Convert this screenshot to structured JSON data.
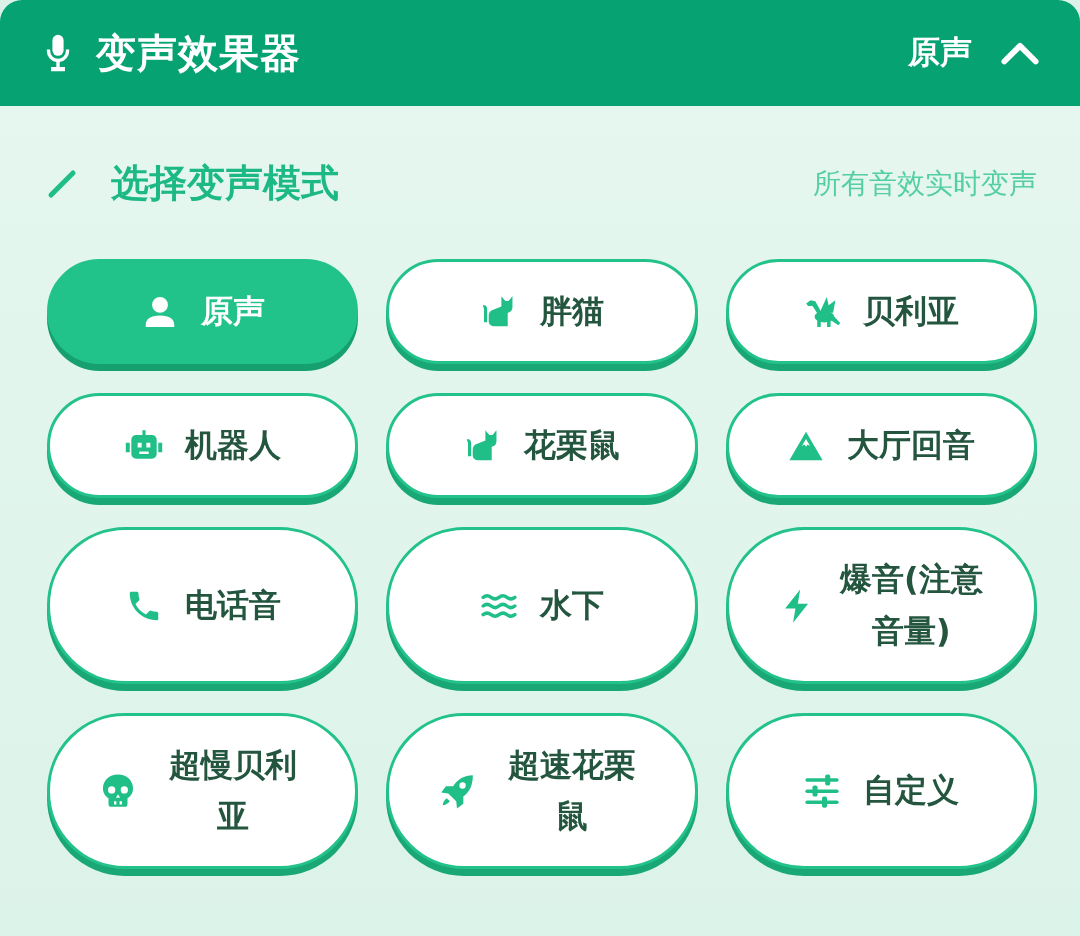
{
  "header": {
    "title": "变声效果器",
    "current_mode": "原声",
    "expanded": true
  },
  "section": {
    "title": "选择变声模式",
    "hint": "所有音效实时变声"
  },
  "modes": [
    {
      "label": "原声",
      "selected": true
    },
    {
      "label": "胖猫",
      "selected": false
    },
    {
      "label": "贝利亚",
      "selected": false
    },
    {
      "label": "机器人",
      "selected": false
    },
    {
      "label": "花栗鼠",
      "selected": false
    },
    {
      "label": "大厅回音",
      "selected": false
    },
    {
      "label": "电话音",
      "selected": false
    },
    {
      "label": "水下",
      "selected": false
    },
    {
      "label": "爆音(注意音量)",
      "selected": false
    },
    {
      "label": "超慢贝利亚",
      "selected": false
    },
    {
      "label": "超速花栗鼠",
      "selected": false
    },
    {
      "label": "自定义",
      "selected": false
    }
  ]
}
